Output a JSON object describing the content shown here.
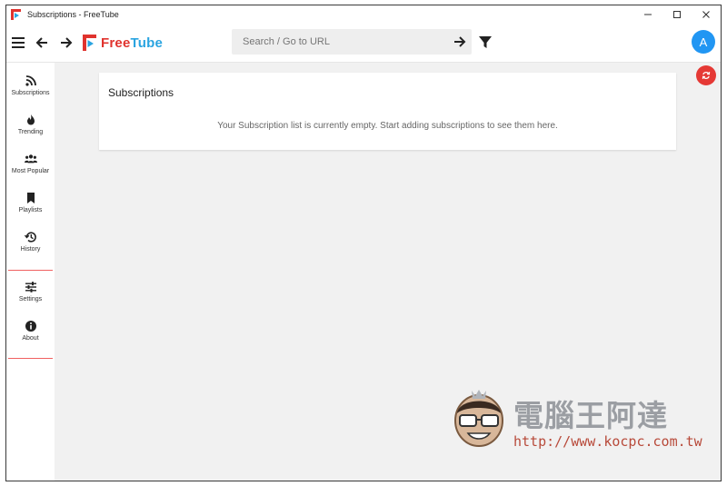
{
  "window": {
    "title": "Subscriptions - FreeTube",
    "controls": [
      "minimize-icon",
      "maximize-icon",
      "close-icon"
    ]
  },
  "topbar": {
    "brand_free": "Free",
    "brand_tube": "Tube",
    "search_placeholder": "Search / Go to URL",
    "search_value": "",
    "avatar_letter": "A",
    "icons": [
      "hamburger-menu-icon",
      "back-arrow-icon",
      "forward-arrow-icon",
      "search-go-arrow-icon",
      "filter-icon"
    ]
  },
  "sidebar": {
    "items": [
      {
        "label": "Subscriptions",
        "icon": "rss-icon"
      },
      {
        "label": "Trending",
        "icon": "fire-icon"
      },
      {
        "label": "Most Popular",
        "icon": "users-icon"
      },
      {
        "label": "Playlists",
        "icon": "bookmark-icon"
      },
      {
        "label": "History",
        "icon": "history-icon"
      },
      {
        "label": "Settings",
        "icon": "sliders-icon"
      },
      {
        "label": "About",
        "icon": "info-icon"
      }
    ]
  },
  "main": {
    "card_title": "Subscriptions",
    "empty_message": "Your Subscription list is currently empty. Start adding subscriptions to see them here."
  },
  "watermark": {
    "title": "電腦王阿達",
    "url": "http://www.kocpc.com.tw"
  },
  "colors": {
    "brand_red": "#e0332e",
    "brand_blue": "#2aa4e0",
    "avatar_blue": "#2196f3",
    "refresh_red": "#e53935",
    "separator_red": "#f06060"
  }
}
